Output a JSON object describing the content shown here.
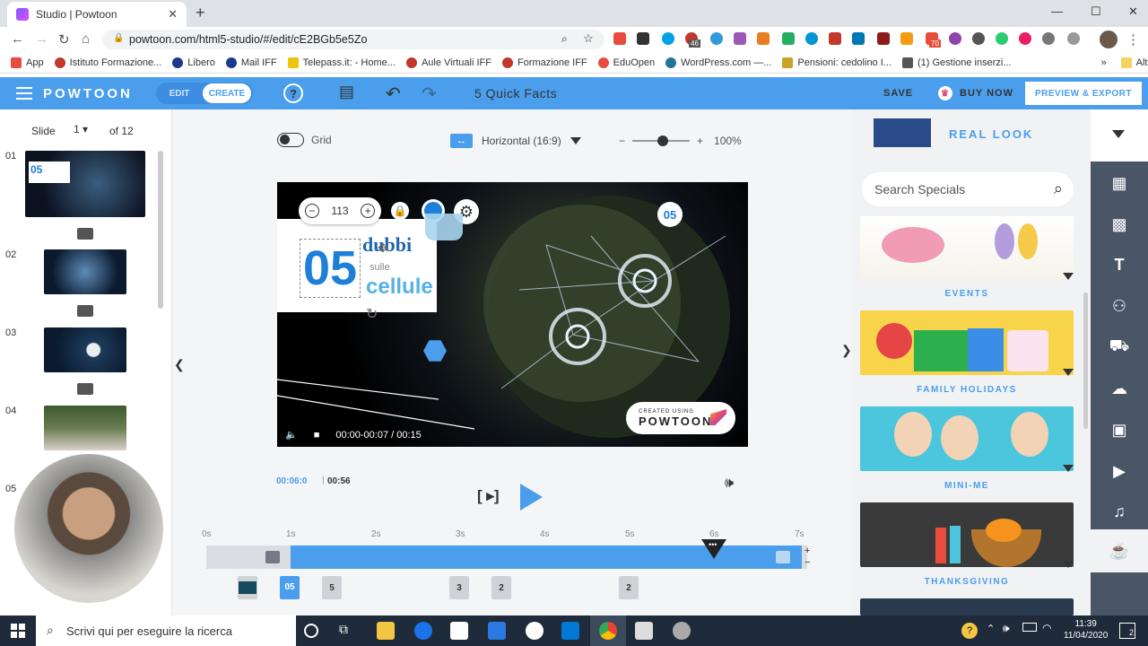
{
  "browser": {
    "tab_title": "Studio | Powtoon",
    "url": "powtoon.com/html5-studio/#/edit/cE2BGb5e5Zo",
    "bookmarks": [
      "App",
      "Istituto Formazione...",
      "Libero",
      "Mail IFF",
      "Telepass.it: - Home...",
      "Aule Virtuali IFF",
      "Formazione IFF",
      "EduOpen",
      "WordPress.com —...",
      "Pensioni: cedolino I...",
      "(1) Gestione inserzi..."
    ],
    "bookmarks_more": "»",
    "other_bookmarks": "Altri Preferiti",
    "ext_badges": [
      "46",
      "70"
    ]
  },
  "header": {
    "logo": "POWTOON",
    "mode_edit": "EDIT",
    "mode_create": "CREATE",
    "project_title": "5 Quick Facts",
    "save": "SAVE",
    "buy_now": "BUY NOW",
    "preview_export": "PREVIEW & EXPORT"
  },
  "slides": {
    "label": "Slide",
    "current": "1",
    "of_total": "of 12",
    "numbers": [
      "01",
      "02",
      "03",
      "04",
      "05"
    ]
  },
  "stage": {
    "grid_label": "Grid",
    "orientation": "Horizontal (16:9)",
    "zoom_minus": "−",
    "zoom_plus": "+",
    "zoom_pct": "100%",
    "toolbar_value": "113",
    "title_number": "05",
    "title_word1": "dubbi",
    "title_word2": "sulle",
    "title_word3": "cellule",
    "pin_label": "05",
    "credit_small": "CREATED USING",
    "credit_brand": "POWTOON",
    "player_time": "00:00-00:07 / 00:15"
  },
  "timeline": {
    "current": "00:06:0",
    "total": "00:56",
    "ticks": [
      "0s",
      "1s",
      "2s",
      "3s",
      "4s",
      "5s",
      "6s",
      "7s"
    ],
    "badges": [
      "05",
      "5",
      "3",
      "2",
      "2"
    ],
    "add": "+",
    "remove": "−"
  },
  "right_panel": {
    "style_title": "REAL LOOK",
    "search_placeholder": "Search Specials",
    "categories": [
      "EVENTS",
      "FAMILY HOLIDAYS",
      "MINI-ME",
      "THANKSGIVING"
    ]
  },
  "taskbar": {
    "search_placeholder": "Scrivi qui per eseguire la ricerca",
    "time": "11:39",
    "date": "11/04/2020",
    "notif_count": "2"
  },
  "colors": {
    "brand_blue": "#4a9eec",
    "tool_rail": "#4a5566",
    "title_blue": "#1d7fd8"
  }
}
